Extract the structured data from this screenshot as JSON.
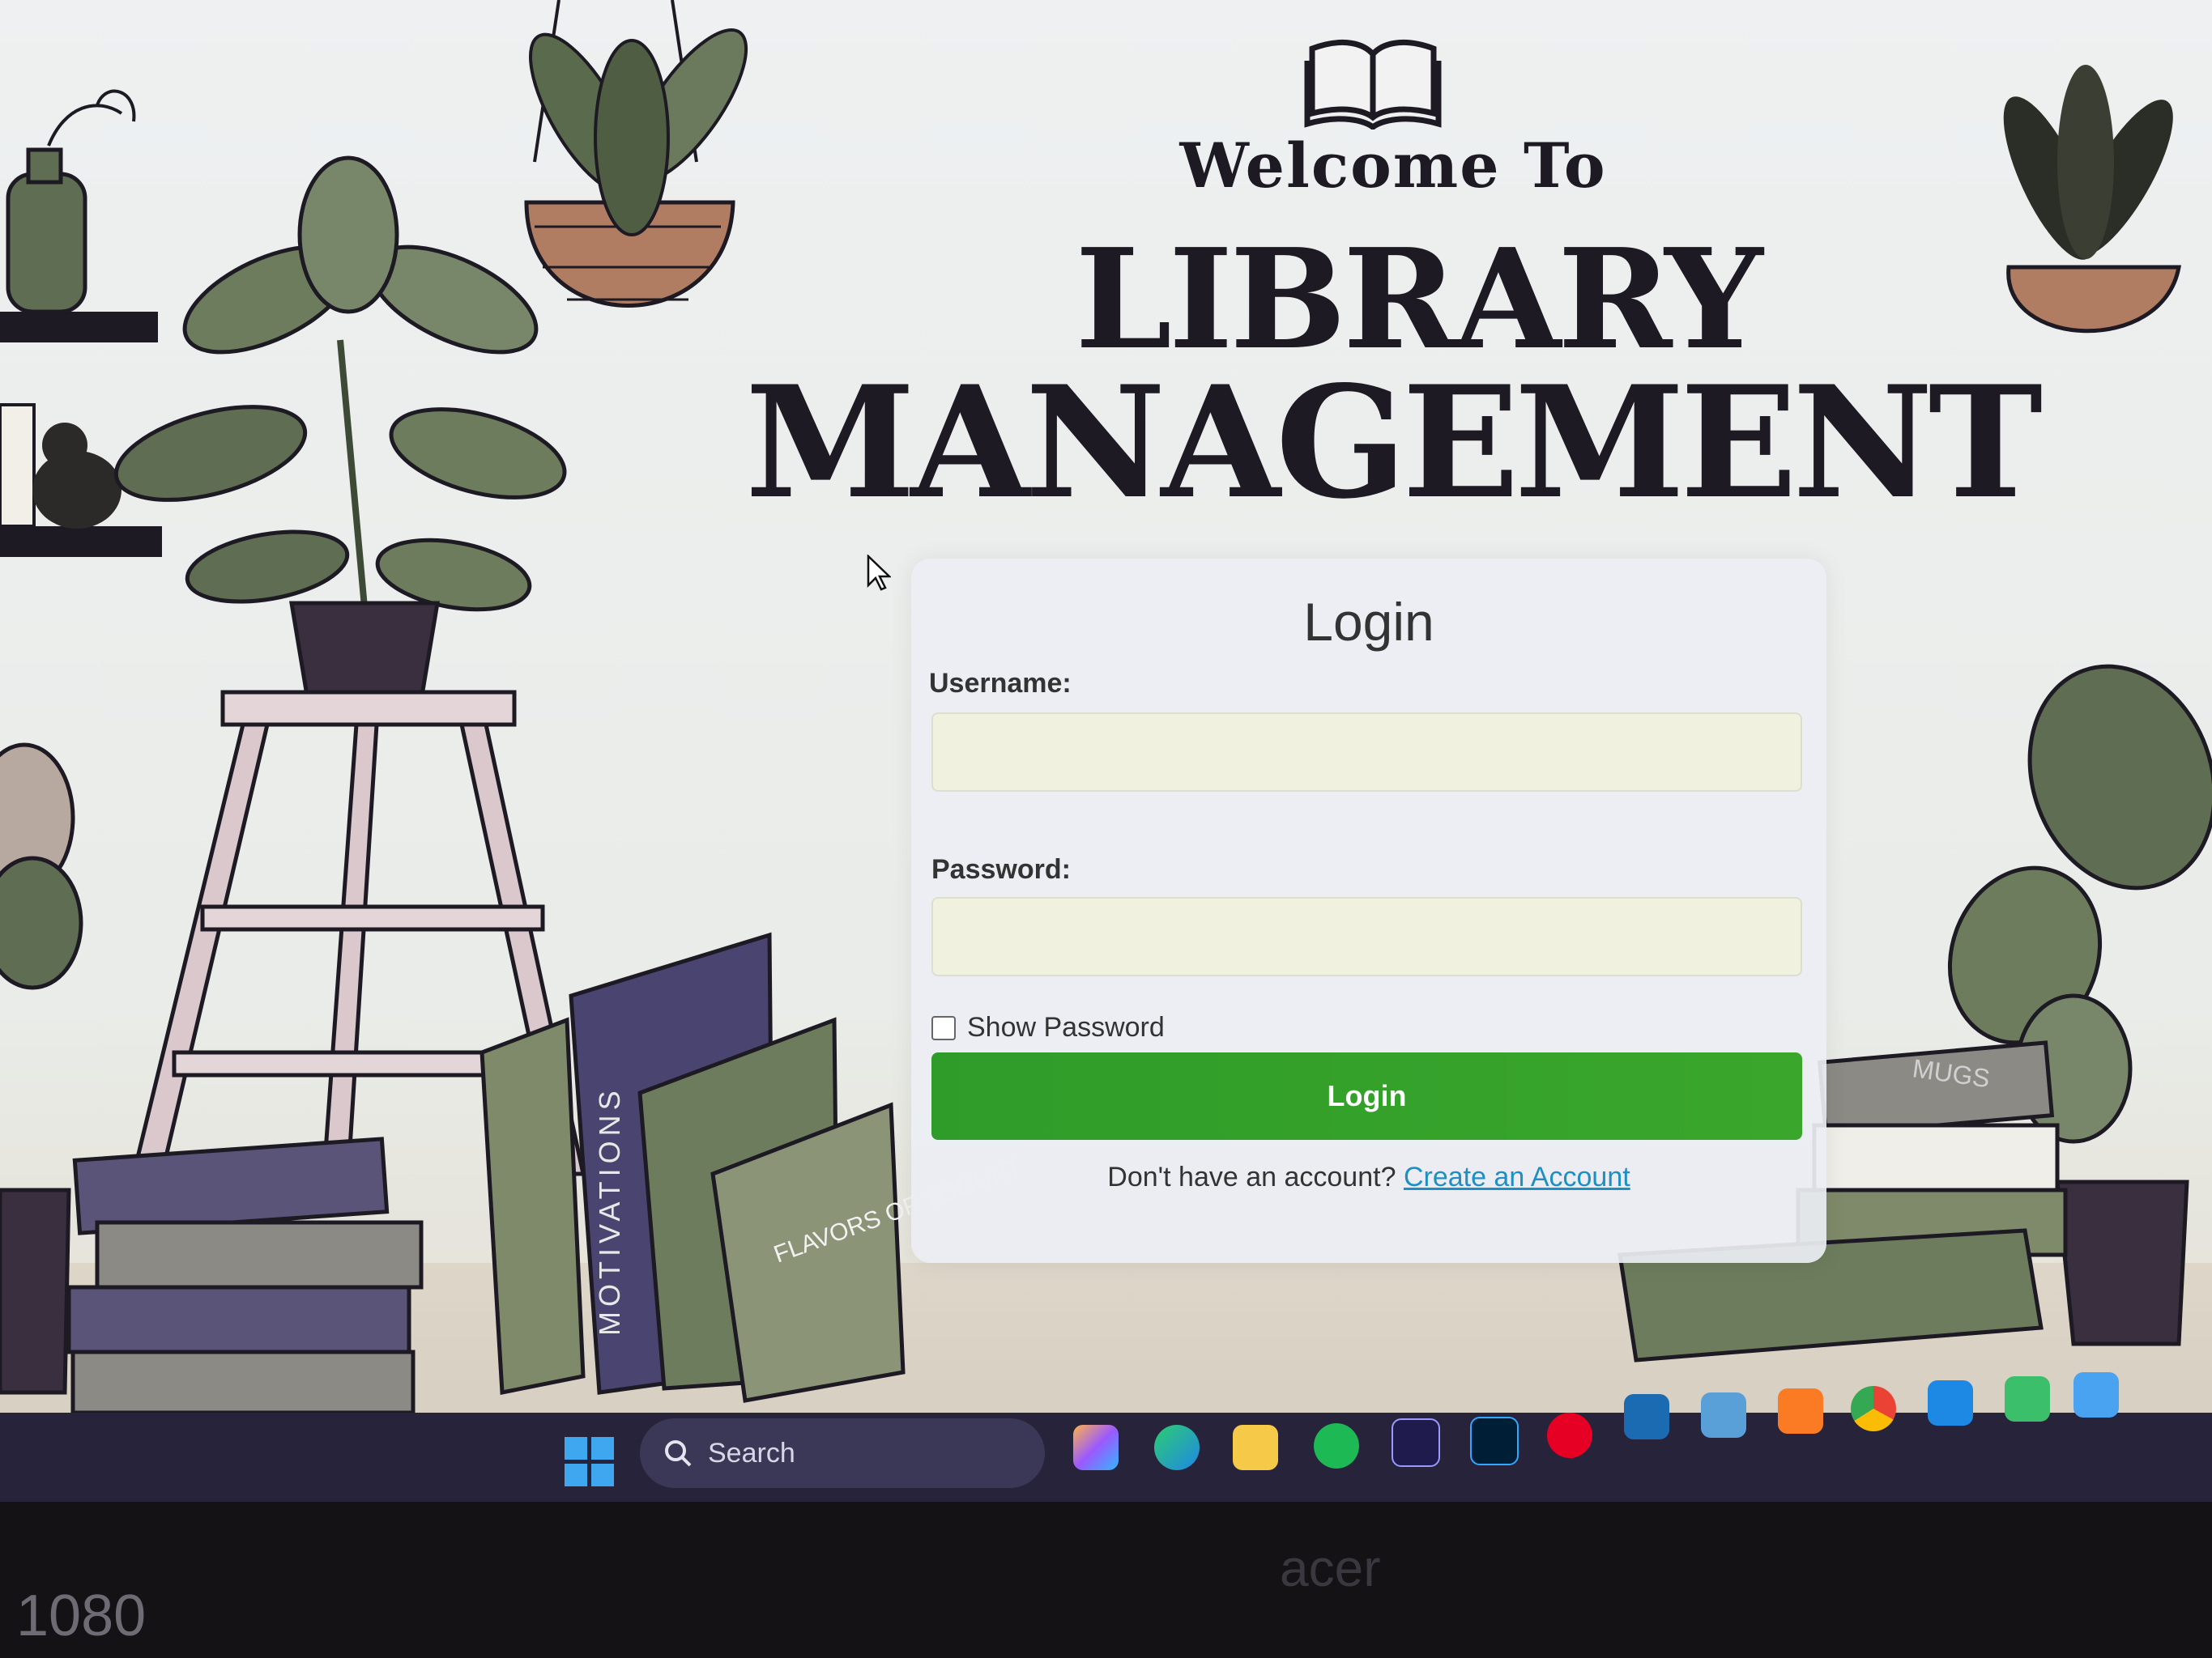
{
  "header": {
    "welcome": "Welcome To",
    "title_line1": "LIBRARY",
    "title_line2": "MANAGEMENT"
  },
  "login": {
    "title": "Login",
    "username_label": "Username:",
    "username_value": "",
    "password_label": "Password:",
    "password_value": "",
    "show_password_label": "Show Password",
    "show_password_checked": false,
    "button_label": "Login",
    "signup_prompt": "Don't have an account?",
    "signup_link": "Create an Account"
  },
  "decor": {
    "book_spines": [
      "MOTIVATIONS",
      "FLAVORS OF YOGURT",
      "MUGS"
    ]
  },
  "taskbar": {
    "search_placeholder": "Search",
    "pinned_apps": [
      "windows-start",
      "copilot",
      "edge",
      "file-explorer",
      "spotify",
      "premiere-pro",
      "photoshop",
      "pinterest",
      "snipping-tool",
      "remote-desktop",
      "xampp",
      "chrome",
      "vscode",
      "notepad",
      "paint"
    ]
  },
  "bezel": {
    "brand": "acer",
    "resolution_label": "1080"
  },
  "colors": {
    "accent_green": "#2f9c2a",
    "link_blue": "#1e8fc4",
    "title_dark": "#1d1a24",
    "plant_green": "#5f6d52",
    "book_purple": "#4a4570"
  }
}
